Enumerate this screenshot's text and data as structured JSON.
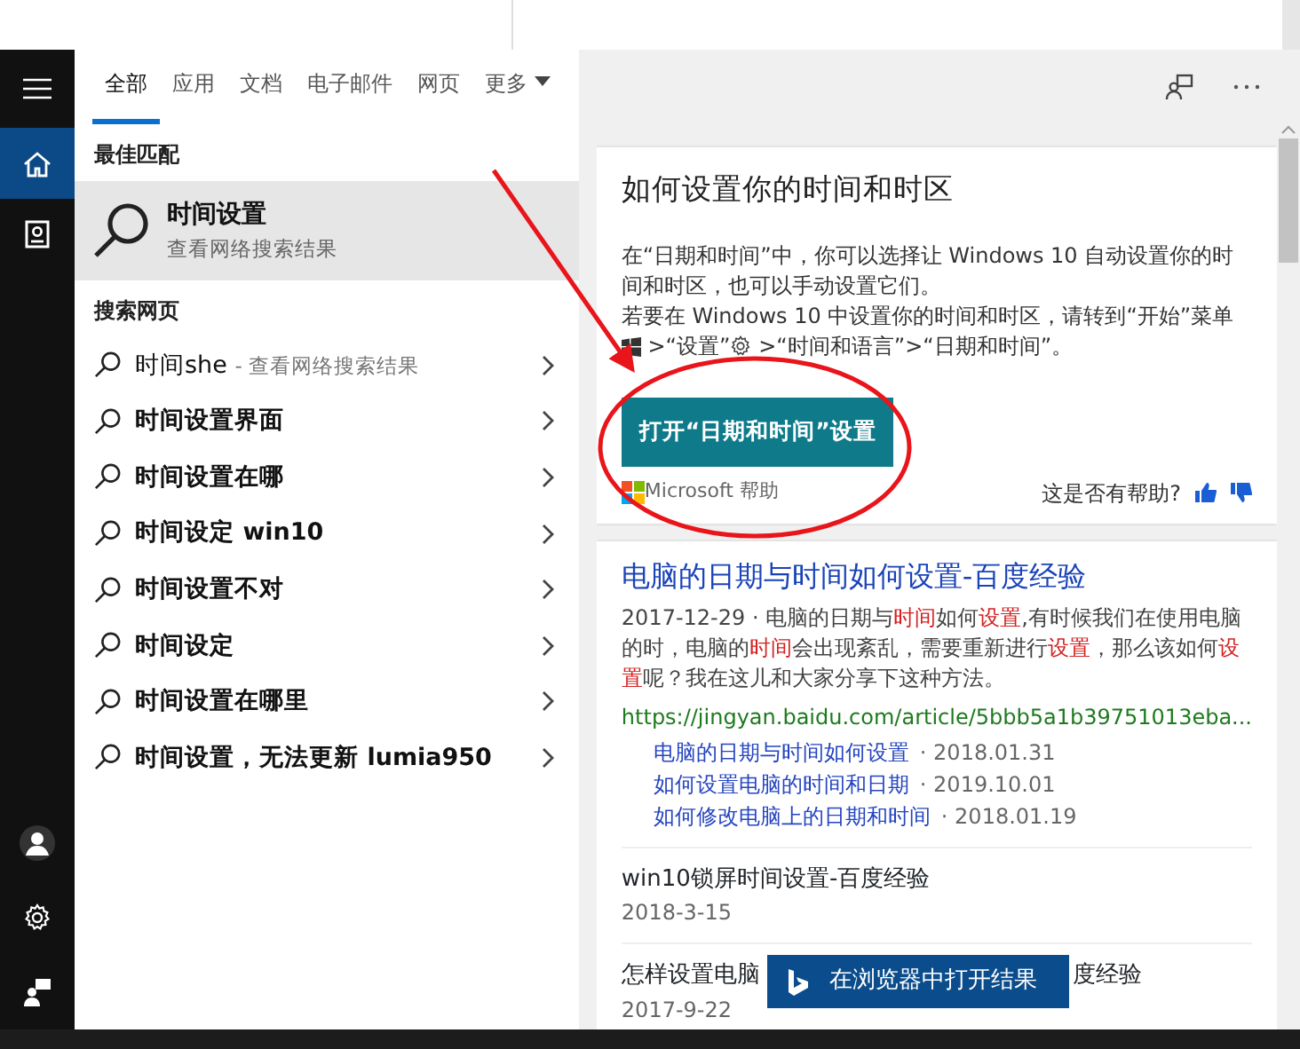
{
  "sidebar": {
    "items": [
      {
        "kind": "menu",
        "selected": false
      },
      {
        "kind": "home",
        "selected": true
      },
      {
        "kind": "notebook",
        "selected": false
      }
    ],
    "bottom_items": [
      {
        "kind": "user"
      },
      {
        "kind": "settings"
      },
      {
        "kind": "feedback"
      }
    ]
  },
  "tabs": [
    {
      "label": "全部",
      "selected": true
    },
    {
      "label": "应用",
      "selected": false
    },
    {
      "label": "文档",
      "selected": false
    },
    {
      "label": "电子邮件",
      "selected": false
    },
    {
      "label": "网页",
      "selected": false
    },
    {
      "label": "更多",
      "selected": false,
      "dropdown": true
    }
  ],
  "best_match": {
    "heading": "最佳匹配",
    "title": "时间设置",
    "subtitle": "查看网络搜索结果",
    "selected": true
  },
  "web_search": {
    "heading": "搜索网页",
    "items": [
      {
        "kind": "typed",
        "text": "时间she",
        "suffix": "- 查看网络搜索结果"
      },
      {
        "kind": "suggestion",
        "text": "时间设置界面"
      },
      {
        "kind": "suggestion",
        "text": "时间设置在哪"
      },
      {
        "kind": "suggestion",
        "text": "时间设定 win10"
      },
      {
        "kind": "suggestion",
        "text": "时间设置不对"
      },
      {
        "kind": "suggestion",
        "text": "时间设定"
      },
      {
        "kind": "suggestion",
        "text": "时间设置在哪里"
      },
      {
        "kind": "suggestion",
        "text": "时间设置，无法更新 lumia950"
      }
    ]
  },
  "answer_card": {
    "title": "如何设置你的时间和时区",
    "paragraphs": [
      [
        {
          "kind": "text",
          "text": "在“日期和时间”中，你可以选择让 Windows 10 自动设置你的时间和时区，也可以手动设置它们。"
        }
      ],
      [
        {
          "kind": "text",
          "text": "若要在 Windows 10 中设置你的时间和时区，请转到“开始”菜单"
        },
        {
          "kind": "windows"
        },
        {
          "kind": "text",
          "text": ">“设置”"
        },
        {
          "kind": "gear"
        },
        {
          "kind": "text",
          "text": ">“时间和语言”>“日期和时间”。"
        }
      ]
    ],
    "button": "打开“日期和时间”设置",
    "source": "Microsoft 帮助",
    "feedback": "这是否有帮助?"
  },
  "results": {
    "main": {
      "title": "电脑的日期与时间如何设置-百度经验",
      "snippet": [
        {
          "text": "2017-12-29 · 电脑的日期与",
          "highlight": false
        },
        {
          "text": "时间",
          "highlight": true
        },
        {
          "text": "如何",
          "highlight": false
        },
        {
          "text": "设置",
          "highlight": true
        },
        {
          "text": ",有时候我们在使用电脑的时，电脑的",
          "highlight": false
        },
        {
          "text": "时间",
          "highlight": true
        },
        {
          "text": "会出现紊乱，需要重新进行",
          "highlight": false
        },
        {
          "text": "设置",
          "highlight": true
        },
        {
          "text": "，那么该如何",
          "highlight": false
        },
        {
          "text": "设置",
          "highlight": true
        },
        {
          "text": "呢？我在这儿和大家分享下这种方法。",
          "highlight": false
        }
      ],
      "url": "https://jingyan.baidu.com/article/5bbb5a1b39751013eba...",
      "sublinks": [
        {
          "title": "电脑的日期与时间如何设置",
          "date": "· 2018.01.31"
        },
        {
          "title": "如何设置电脑的时间和日期",
          "date": "· 2019.10.01"
        },
        {
          "title": "如何修改电脑上的日期和时间",
          "date": "· 2018.01.19"
        }
      ]
    },
    "more": [
      {
        "title_parts": [
          "win10锁屏时间设置-百度经验"
        ],
        "date": "2018-3-15"
      },
      {
        "title_parts": [
          "怎样设置电脑",
          "度经验"
        ],
        "date": "2017-9-22"
      }
    ]
  },
  "open_in_browser": "在浏览器中打开结果"
}
